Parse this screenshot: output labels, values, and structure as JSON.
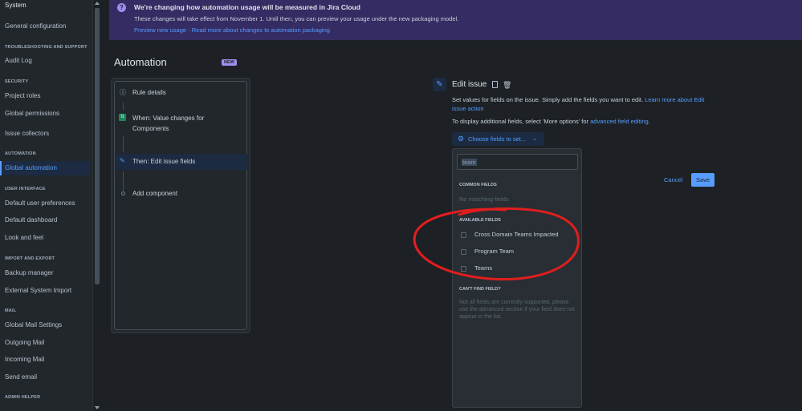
{
  "sidebar": {
    "system": "System",
    "general_configuration": "General configuration",
    "sections": {
      "troubleshooting": "TROUBLESHOOTING AND SUPPORT",
      "security": "SECURITY",
      "automation": "AUTOMATION",
      "user_interface": "USER INTERFACE",
      "import_export": "IMPORT AND EXPORT",
      "mail": "MAIL",
      "admin_helper": "ADMIN HELPER"
    },
    "items": {
      "audit_log": "Audit Log",
      "project_roles": "Project roles",
      "global_permissions": "Global permissions",
      "issue_collectors": "Issue collectors",
      "global_automation": "Global automation",
      "default_user_preferences": "Default user preferences",
      "default_dashboard": "Default dashboard",
      "look_and_feel": "Look and feel",
      "backup_manager": "Backup manager",
      "external_system_import": "External System Import",
      "global_mail_settings": "Global Mail Settings",
      "outgoing_mail": "Outgoing Mail",
      "incoming_mail": "Incoming Mail",
      "send_email": "Send email"
    }
  },
  "banner": {
    "icon": "?",
    "title": "We're changing how automation usage will be measured in Jira Cloud",
    "text": "These changes will take effect from November 1. Until then, you can preview your usage under the new packaging model.",
    "link1": "Preview new usage",
    "separator": "·",
    "link2": "Read more about changes to automation packaging"
  },
  "automation": {
    "title": "Automation",
    "badge": "NEW"
  },
  "rule": {
    "details": "Rule details",
    "trigger": "When: Value changes for Components",
    "action": "Then: Edit issue fields",
    "add_component": "Add component"
  },
  "edit": {
    "title": "Edit issue",
    "description": "Set values for fields on the issue. Simply add the fields you want to edit.",
    "description_link": "Learn more about Edit issue action",
    "more_prefix": "To display additional fields, select 'More options' for",
    "more_link": "advanced field editing",
    "more_suffix": ".",
    "choose_button": "Choose fields to set...",
    "cancel": "Cancel",
    "save": "Save"
  },
  "dropdown": {
    "search_value": "team",
    "common_heading": "COMMON FIELDS",
    "common_empty": "No matching fields",
    "available_heading": "AVAILABLE FIELDS",
    "options": [
      "Cross Domain Teams Impacted",
      "Program Team",
      "Teams"
    ],
    "cant_find_heading": "CAN'T FIND FIELD?",
    "cant_find_text": "Not all fields are currently supported, please use the advanced section if your field does not appear in the list."
  },
  "colors": {
    "accent": "#579dff",
    "annotation": "#e01e1e",
    "banner": "#352c63"
  }
}
